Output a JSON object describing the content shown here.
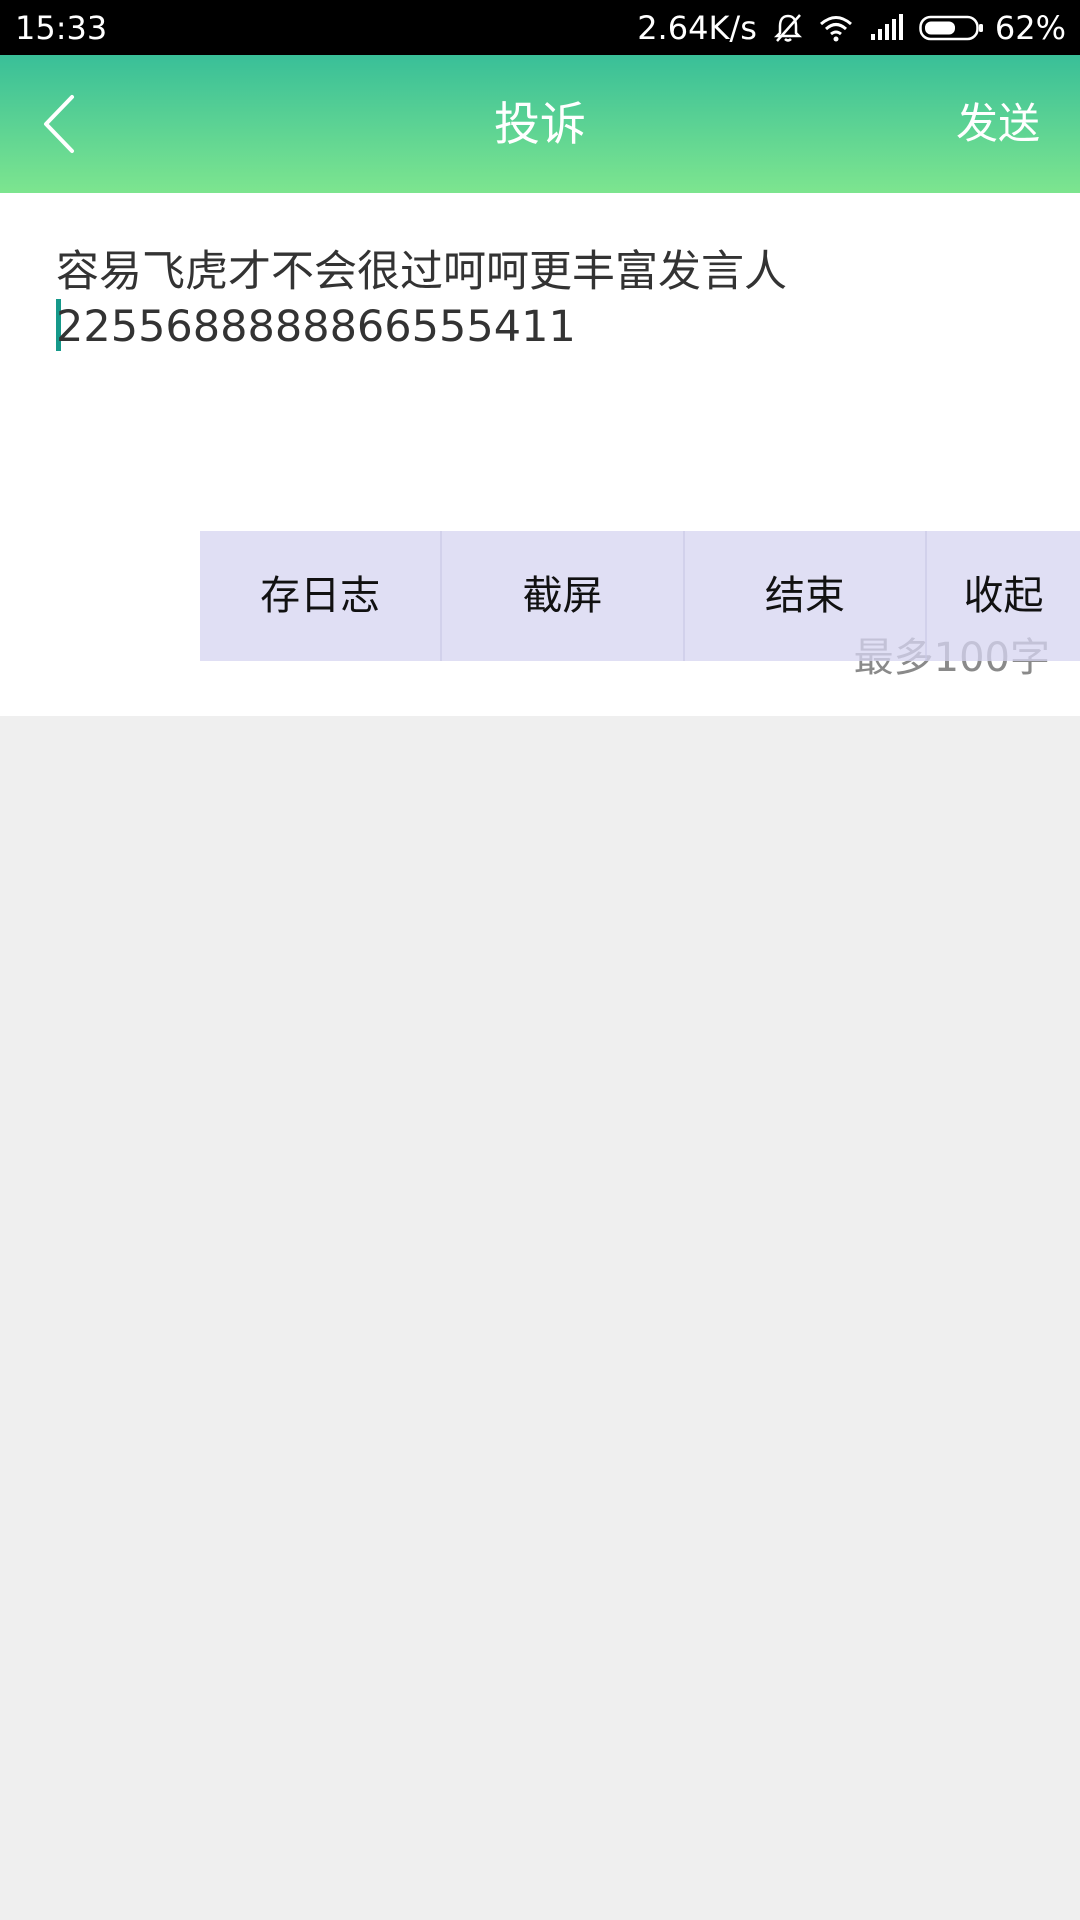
{
  "status_bar": {
    "time": "15:33",
    "net_speed": "2.64K/s",
    "battery_percent": "62%",
    "icons": [
      "bell-muted-icon",
      "wifi-icon",
      "signal-icon",
      "battery-icon"
    ],
    "battery_level": 0.62
  },
  "header": {
    "title": "投诉",
    "send_label": "发送",
    "back_icon": "chevron-left-icon",
    "gradient_top": "#39bf98",
    "gradient_bottom": "#7de58f"
  },
  "form": {
    "text_lines": [
      "容易飞虎才不会很过呵呵更丰富发言人",
      "2255688888866555411"
    ],
    "char_limit": "最多100字"
  },
  "debug_toolbar": {
    "items": [
      "存日志",
      "截屏",
      "结束",
      "收起"
    ]
  }
}
